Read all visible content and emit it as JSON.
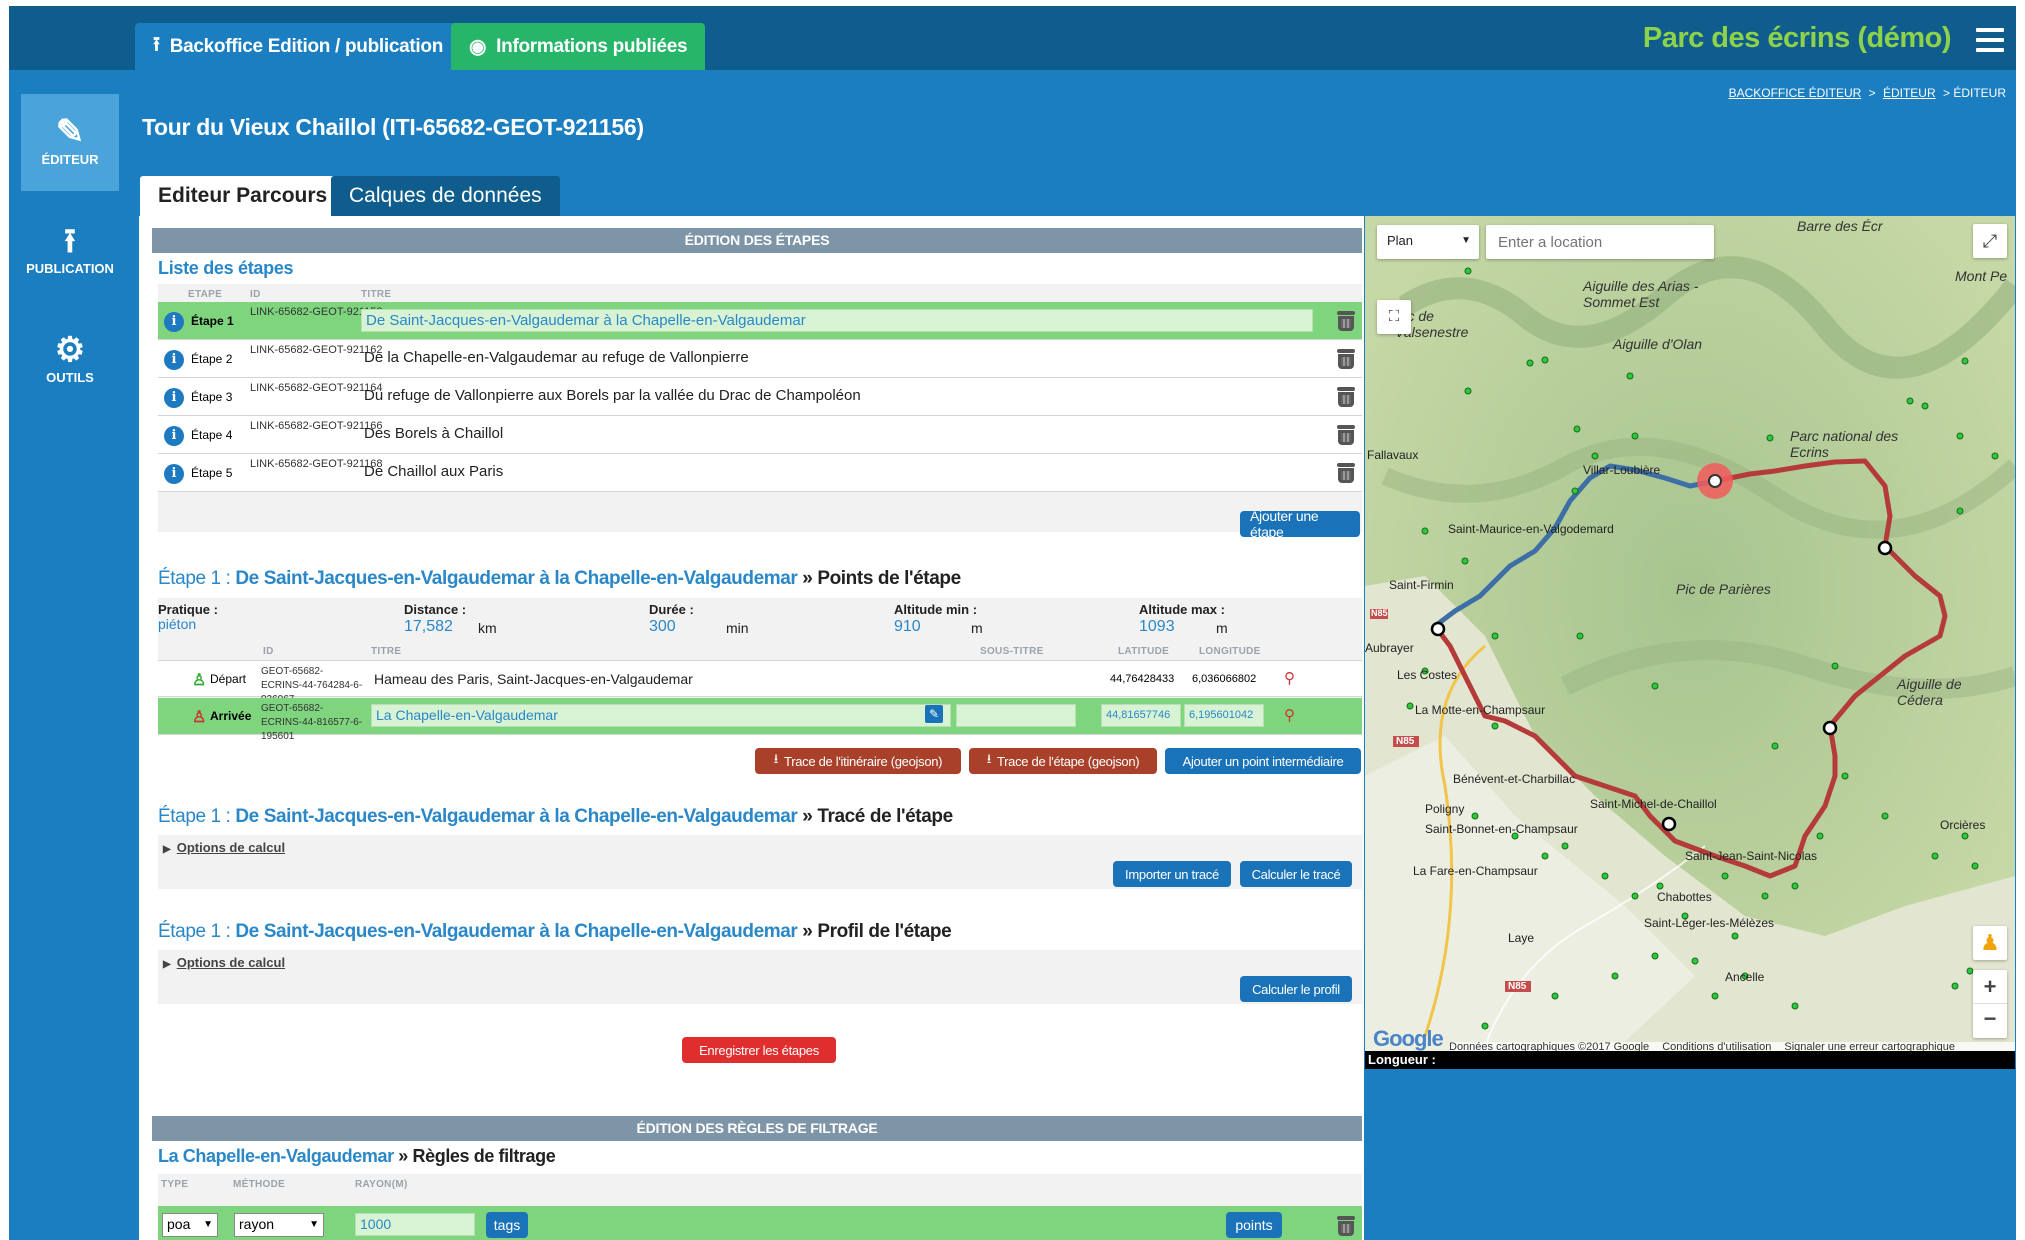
{
  "header": {
    "tab_backoffice": "Backoffice Edition / publication",
    "tab_published": "Informations publiées",
    "brand": "Parc des écrins (démo)"
  },
  "sidebar": {
    "items": [
      {
        "label": "ÉDITEUR",
        "icon": "pencil-icon",
        "active": true
      },
      {
        "label": "PUBLICATION",
        "icon": "upload-icon",
        "active": false
      },
      {
        "label": "OUTILS",
        "icon": "gear-icon",
        "active": false
      }
    ]
  },
  "breadcrumb": {
    "items": [
      "BACKOFFICE ÉDITEUR",
      "ÉDITEUR"
    ],
    "current": "ÉDITEUR"
  },
  "page": {
    "title": "Tour du Vieux Chaillol (ITI-65682-GEOT-921156)"
  },
  "subtabs": [
    "Editeur Parcours",
    "Calques de données"
  ],
  "steps_section": {
    "header": "ÉDITION DES ÉTAPES",
    "list_title": "Liste des étapes",
    "columns": [
      "ETAPE",
      "ID",
      "TITRE"
    ],
    "rows": [
      {
        "etape": "Étape 1",
        "id": "LINK-65682-GEOT-921158",
        "title": "De Saint-Jacques-en-Valgaudemar à la Chapelle-en-Valgaudemar",
        "selected": true
      },
      {
        "etape": "Étape 2",
        "id": "LINK-65682-GEOT-921162",
        "title": "De la Chapelle-en-Valgaudemar au refuge de Vallonpierre",
        "selected": false
      },
      {
        "etape": "Étape 3",
        "id": "LINK-65682-GEOT-921164",
        "title": "Du refuge de Vallonpierre aux Borels par la vallée du Drac de Champoléon",
        "selected": false
      },
      {
        "etape": "Étape 4",
        "id": "LINK-65682-GEOT-921166",
        "title": "Des Borels à Chaillol",
        "selected": false
      },
      {
        "etape": "Étape 5",
        "id": "LINK-65682-GEOT-921168",
        "title": "De Chaillol aux Paris",
        "selected": false
      }
    ],
    "add_button": "Ajouter une étape"
  },
  "points": {
    "prefix": "Étape 1 : ",
    "step_title": "De Saint-Jacques-en-Valgaudemar à la Chapelle-en-Valgaudemar",
    "suffix": "» Points de l'étape",
    "pratique_label": "Pratique :",
    "pratique_value": "piéton",
    "distance_label": "Distance :",
    "distance_value": "17,582",
    "distance_unit": "km",
    "duree_label": "Durée :",
    "duree_value": "300",
    "duree_unit": "min",
    "altmin_label": "Altitude min :",
    "altmin_value": "910",
    "altmin_unit": "m",
    "altmax_label": "Altitude max :",
    "altmax_value": "1093",
    "altmax_unit": "m",
    "columns": [
      "ID",
      "TITRE",
      "SOUS-TITRE",
      "LATITUDE",
      "LONGITUDE"
    ],
    "rows": [
      {
        "kind": "Départ",
        "id": "GEOT-65682-ECRINS-44-764284-6-036067",
        "title": "Hameau des Paris, Saint-Jacques-en-Valgaudemar",
        "lat": "44,76428433",
        "lon": "6,036066802",
        "selected": false
      },
      {
        "kind": "Arrivée",
        "id": "GEOT-65682-ECRINS-44-816577-6-195601",
        "title": "La Chapelle-en-Valgaudemar",
        "lat": "44,81657746",
        "lon": "6,195601042",
        "selected": true
      }
    ],
    "btn_trace_itineraire": "Trace de l'itinéraire (geojson)",
    "btn_trace_etape": "Trace de l'étape (geojson)",
    "btn_add_point": "Ajouter un point intermédiaire"
  },
  "trace": {
    "suffix": "» Tracé de l'étape",
    "options": "Options de calcul",
    "btn_import": "Importer un tracé",
    "btn_calc": "Calculer le tracé"
  },
  "profile": {
    "suffix": "» Profil de l'étape",
    "options": "Options de calcul",
    "btn_calc": "Calculer le profil"
  },
  "save_button": "Enregistrer les étapes",
  "filter": {
    "header": "ÉDITION DES RÈGLES DE FILTRAGE",
    "place": "La Chapelle-en-Valgaudemar",
    "suffix": "» Règles de filtrage",
    "columns": [
      "TYPE",
      "MÉTHODE",
      "RAYON(M)"
    ],
    "type": "poa",
    "method": "rayon",
    "radius": "1000",
    "tags_button": "tags",
    "points_button": "points"
  },
  "map": {
    "type_select": "Plan",
    "search_placeholder": "Enter a location",
    "length_label": "Longueur :",
    "attribution": "Données cartographiques ©2017 Google",
    "terms": "Conditions d'utilisation",
    "report": "Signaler une erreur cartographique",
    "google": "Google",
    "labels": [
      "Barre des Écr",
      "Mont Pe",
      "Aiguille des Arias - Sommet Est",
      "Aiguille d'Olan",
      "Pic de Valsenestre",
      "Parc national des Ecrins",
      "Pic de Parières",
      "Aiguille de Cédera"
    ],
    "places": [
      "Fallavaux",
      "Villar-Loubière",
      "Saint-Maurice-en-Valgodemard",
      "Saint-Firmin",
      "Aubrayer",
      "Les Costes",
      "La Motte-en-Champsaur",
      "Bénévent-et-Charbillac",
      "Poligny",
      "Saint-Michel-de-Chaillol",
      "Saint-Bonnet-en-Champsaur",
      "La Fare-en-Champsaur",
      "Saint-Jean-Saint-Nicolas",
      "Orcières",
      "Chabottes",
      "Saint-Léger-les-Mélèzes",
      "Laye",
      "Ancelle"
    ],
    "roads": [
      "N85",
      "N85",
      "N85"
    ]
  }
}
